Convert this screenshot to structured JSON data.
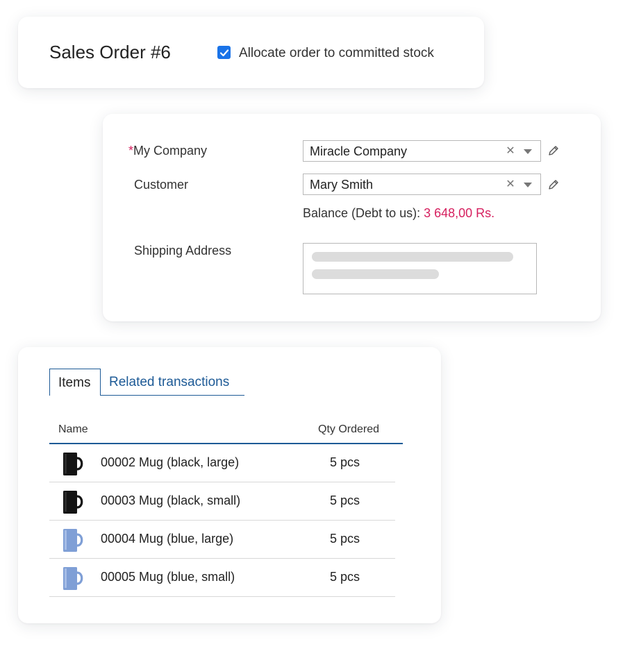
{
  "order": {
    "title": "Sales Order #6",
    "allocate_checked": true,
    "allocate_label": "Allocate order to committed stock"
  },
  "form": {
    "company": {
      "required_mark": "*",
      "label": "My Company",
      "value": "Miracle Company"
    },
    "customer": {
      "label": "Customer",
      "value": "Mary Smith"
    },
    "balance": {
      "label": "Balance (Debt to us): ",
      "amount": "3 648,00 Rs.",
      "amount_color": "#d6205f"
    },
    "shipping": {
      "label": "Shipping Address"
    }
  },
  "items_panel": {
    "tabs": [
      {
        "label": "Items",
        "active": true
      },
      {
        "label": "Related transactions",
        "active": false
      }
    ],
    "columns": {
      "name": "Name",
      "qty": "Qty Ordered"
    },
    "rows": [
      {
        "name": "00002 Mug (black, large)",
        "qty": "5 pcs",
        "icon": "black-mug-icon"
      },
      {
        "name": "00003 Mug (black, small)",
        "qty": "5 pcs",
        "icon": "black-mug-icon"
      },
      {
        "name": "00004 Mug (blue, large)",
        "qty": "5 pcs",
        "icon": "blue-mug-icon"
      },
      {
        "name": "00005 Mug (blue, small)",
        "qty": "5 pcs",
        "icon": "blue-mug-icon"
      }
    ]
  },
  "colors": {
    "accent": "#1a73e8",
    "link": "#1d5a96",
    "required": "#d6205f"
  }
}
